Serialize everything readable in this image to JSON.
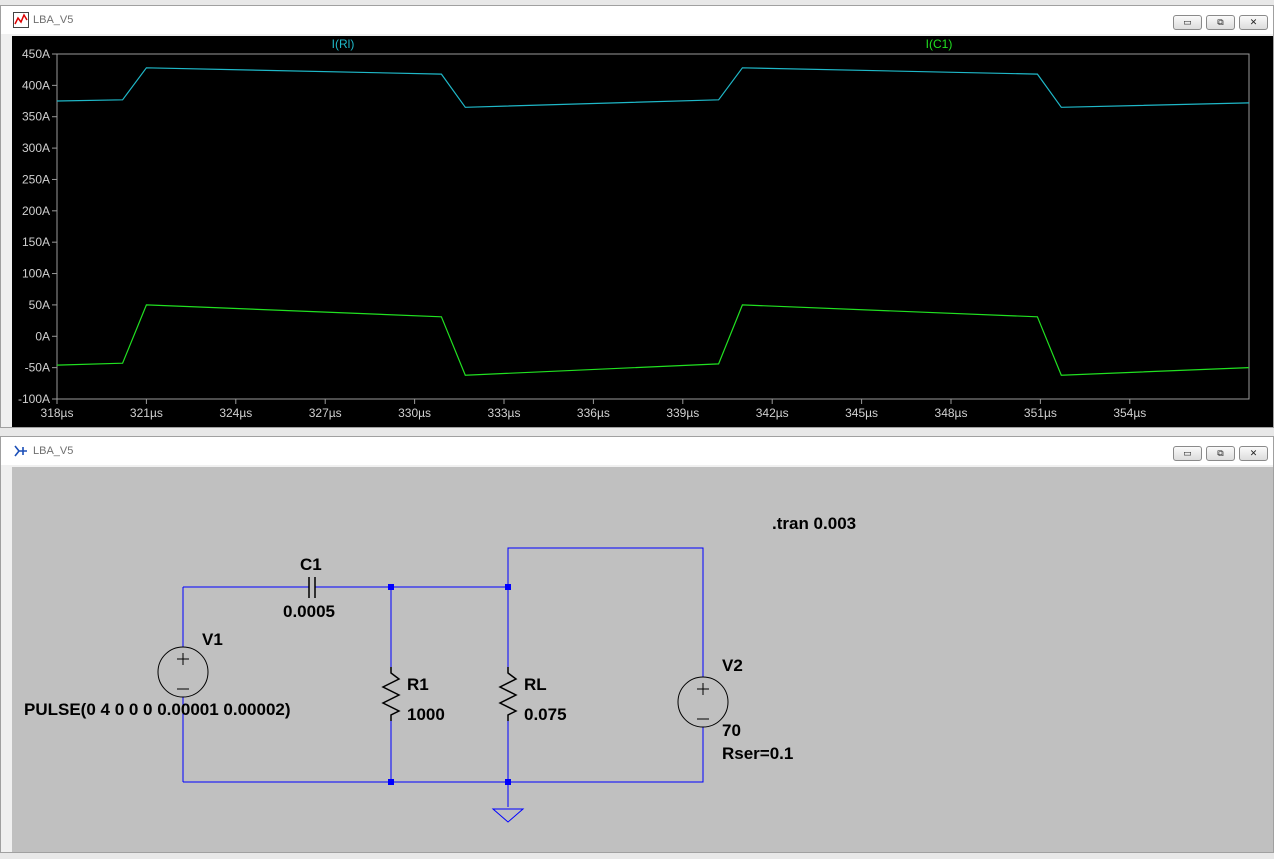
{
  "plot_window": {
    "title": "LBA_V5",
    "controls": {
      "minimize": "▭",
      "restore": "⧉",
      "close": "✕"
    }
  },
  "schematic_window": {
    "title": "LBA_V5",
    "controls": {
      "minimize": "▭",
      "restore": "⧉",
      "close": "✕"
    }
  },
  "colors": {
    "plot_bg": "#000000",
    "trace_rl": "#1fb8c8",
    "trace_c1": "#21e021",
    "schematic_bg": "#c0c0c0",
    "wire": "#0000ff"
  },
  "chart_data": {
    "type": "line",
    "xlim": [
      318,
      358
    ],
    "ylim": [
      -100,
      450
    ],
    "x_unit": "µs",
    "y_unit": "A",
    "x_ticks": [
      "318µs",
      "321µs",
      "324µs",
      "327µs",
      "330µs",
      "333µs",
      "336µs",
      "339µs",
      "342µs",
      "345µs",
      "348µs",
      "351µs",
      "354µs"
    ],
    "y_ticks": [
      "450A",
      "400A",
      "350A",
      "300A",
      "250A",
      "200A",
      "150A",
      "100A",
      "50A",
      "0A",
      "-50A",
      "-100A"
    ],
    "series": [
      {
        "name": "I(Rl)",
        "color": "#1fb8c8",
        "points": [
          [
            318,
            375
          ],
          [
            320.2,
            377
          ],
          [
            321,
            428
          ],
          [
            330.9,
            418
          ],
          [
            331.7,
            365
          ],
          [
            340.2,
            377
          ],
          [
            341,
            428
          ],
          [
            350.9,
            418
          ],
          [
            351.7,
            365
          ],
          [
            358,
            372
          ]
        ]
      },
      {
        "name": "I(C1)",
        "color": "#21e021",
        "points": [
          [
            318,
            -46
          ],
          [
            320.2,
            -43
          ],
          [
            321,
            50
          ],
          [
            330.9,
            31
          ],
          [
            331.7,
            -62
          ],
          [
            340.2,
            -44
          ],
          [
            341,
            50
          ],
          [
            350.9,
            31
          ],
          [
            351.7,
            -62
          ],
          [
            358,
            -50
          ]
        ]
      }
    ]
  },
  "schematic": {
    "directive": ".tran 0.003",
    "c1": {
      "name": "C1",
      "value": "0.0005"
    },
    "v1": {
      "name": "V1",
      "value": "PULSE(0 4 0 0 0 0.00001 0.00002)"
    },
    "r1": {
      "name": "R1",
      "value": "1000"
    },
    "rl": {
      "name": "RL",
      "value": "0.075"
    },
    "v2": {
      "name": "V2",
      "value": "70",
      "rser": "Rser=0.1"
    }
  }
}
